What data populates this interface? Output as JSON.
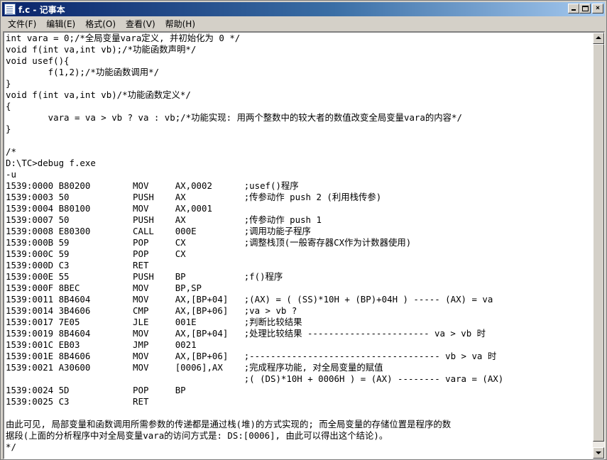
{
  "window": {
    "title": "f.c - 记事本",
    "buttons": {
      "minimize": "",
      "maximize": "",
      "close": "×"
    }
  },
  "menu": [
    {
      "label": "文件(F)"
    },
    {
      "label": "编辑(E)"
    },
    {
      "label": "格式(O)"
    },
    {
      "label": "查看(V)"
    },
    {
      "label": "帮助(H)"
    }
  ],
  "document": {
    "lines": [
      "int vara = 0;/*全局变量vara定义, 并初始化为 0 */",
      "void f(int va,int vb);/*功能函数声明*/",
      "void usef(){",
      "        f(1,2);/*功能函数调用*/",
      "}",
      "void f(int va,int vb)/*功能函数定义*/",
      "{",
      "        vara = va > vb ? va : vb;/*功能实现: 用两个整数中的较大者的数值改变全局变量vara的内容*/",
      "}",
      "",
      "/*",
      "D:\\TC>debug f.exe",
      "-u",
      "1539:0000 B80200        MOV     AX,0002      ;usef()程序",
      "1539:0003 50            PUSH    AX           ;传参动作 push 2 (利用栈传参)",
      "1539:0004 B80100        MOV     AX,0001",
      "1539:0007 50            PUSH    AX           ;传参动作 push 1",
      "1539:0008 E80300        CALL    000E         ;调用功能子程序",
      "1539:000B 59            POP     CX           ;调整栈顶(一般寄存器CX作为计数器使用)",
      "1539:000C 59            POP     CX",
      "1539:000D C3            RET",
      "1539:000E 55            PUSH    BP           ;f()程序",
      "1539:000F 8BEC          MOV     BP,SP",
      "1539:0011 8B4604        MOV     AX,[BP+04]   ;(AX) = ( (SS)*10H + (BP)+04H ) ----- (AX) = va",
      "1539:0014 3B4606        CMP     AX,[BP+06]   ;va > vb ?",
      "1539:0017 7E05          JLE     001E         ;判断比较结果",
      "1539:0019 8B4604        MOV     AX,[BP+04]   ;处理比较结果 ----------------------- va > vb 时",
      "1539:001C EB03          JMP     0021",
      "1539:001E 8B4606        MOV     AX,[BP+06]   ;------------------------------------ vb > va 时",
      "1539:0021 A30600        MOV     [0006],AX    ;完成程序功能, 对全局变量的赋值",
      "                                             ;( (DS)*10H + 0006H ) = (AX) -------- vara = (AX)",
      "1539:0024 5D            POP     BP",
      "1539:0025 C3            RET",
      "",
      "由此可见, 局部变量和函数调用所需参数的传递都是通过栈(堆)的方式实现的; 而全局变量的存储位置是程序的数",
      "据段(上面的分析程序中对全局变量vara的访问方式是: DS:[0006], 由此可以得出这个结论)。",
      "*/"
    ]
  },
  "scrollbar": {
    "position": 0.0
  }
}
